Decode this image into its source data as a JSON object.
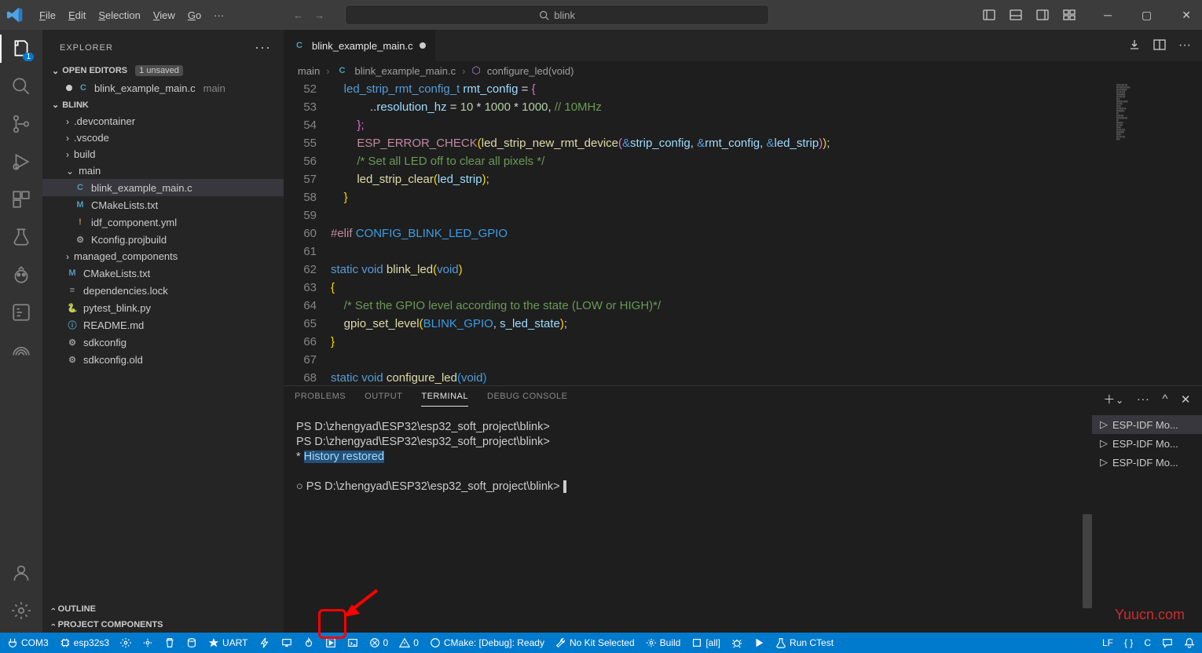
{
  "title": {
    "menus": [
      "File",
      "Edit",
      "Selection",
      "View",
      "Go"
    ],
    "search": "blink"
  },
  "layout_icons": [
    "layout-side",
    "layout-panel",
    "layout-right",
    "layout-grid"
  ],
  "activity": {
    "explorer_badge": "1"
  },
  "sidebar": {
    "title": "EXPLORER",
    "open_editors": {
      "label": "OPEN EDITORS",
      "badge": "1 unsaved"
    },
    "open_file": {
      "name": "blink_example_main.c",
      "folder": "main"
    },
    "project": "BLINK",
    "tree": [
      {
        "d": 1,
        "kind": "folder-closed",
        "label": ".devcontainer"
      },
      {
        "d": 1,
        "kind": "folder-closed",
        "label": ".vscode"
      },
      {
        "d": 1,
        "kind": "folder-closed",
        "label": "build"
      },
      {
        "d": 1,
        "kind": "folder-open",
        "label": "main"
      },
      {
        "d": 2,
        "kind": "c",
        "label": "blink_example_main.c",
        "sel": true
      },
      {
        "d": 2,
        "kind": "m",
        "label": "CMakeLists.txt"
      },
      {
        "d": 2,
        "kind": "ex",
        "label": "idf_component.yml"
      },
      {
        "d": 2,
        "kind": "gear",
        "label": "Kconfig.projbuild"
      },
      {
        "d": 1,
        "kind": "folder-closed",
        "label": "managed_components"
      },
      {
        "d": 1,
        "kind": "m",
        "label": "CMakeLists.txt"
      },
      {
        "d": 1,
        "kind": "lines",
        "label": "dependencies.lock"
      },
      {
        "d": 1,
        "kind": "py",
        "label": "pytest_blink.py"
      },
      {
        "d": 1,
        "kind": "info",
        "label": "README.md"
      },
      {
        "d": 1,
        "kind": "gear",
        "label": "sdkconfig"
      },
      {
        "d": 1,
        "kind": "gear",
        "label": "sdkconfig.old"
      }
    ],
    "outline": "OUTLINE",
    "projcomp": "PROJECT COMPONENTS"
  },
  "editor": {
    "tab": "blink_example_main.c",
    "breadcrumbs": [
      "main",
      "blink_example_main.c",
      "configure_led(void)"
    ],
    "lines": [
      52,
      53,
      54,
      55,
      56,
      57,
      58,
      59,
      60,
      61,
      62,
      63,
      64,
      65,
      66,
      67,
      68
    ],
    "l53_a": ".resolution_hz",
    "l53_b": " = ",
    "l53_c": "10",
    "l53_d": " * ",
    "l53_e": "1000",
    "l53_f": " * ",
    "l53_g": "1000",
    "l53_h": ",",
    "l53_i": " // 10MHz",
    "l54": "};",
    "l55_a": "ESP_ERROR_CHECK",
    "l55_b": "led_strip_new_rmt_device",
    "l55_c": "&",
    "l55_d": "strip_config",
    "l55_e": "rmt_config",
    "l55_f": "led_strip",
    "l56": "/* Set all LED off to clear all pixels */",
    "l57_a": "led_strip_clear",
    "l57_b": "led_strip",
    "l58": "}",
    "l60_a": "#elif",
    "l60_b": " CONFIG_BLINK_LED_GPIO",
    "l62_a": "static",
    "l62_b": "void",
    "l62_c": "blink_led",
    "l62_d": "void",
    "l63": "{",
    "l64": "/* Set the GPIO level according to the state (LOW or HIGH)*/",
    "l65_a": "gpio_set_level",
    "l65_b": "BLINK_GPIO",
    "l65_c": "s_led_state",
    "l66": "}",
    "l68_a": "static",
    "l68_b": "void",
    "l68_c": "configure_led",
    "l68_d": "void"
  },
  "panel": {
    "tabs": [
      "PROBLEMS",
      "OUTPUT",
      "TERMINAL",
      "DEBUG CONSOLE"
    ],
    "active": 2,
    "term_lines": [
      "PS D:\\zhengyad\\ESP32\\esp32_soft_project\\blink>",
      "PS D:\\zhengyad\\ESP32\\esp32_soft_project\\blink>"
    ],
    "hist_prefix": " * ",
    "hist": "History restored",
    "prompt_prefix": "○ ",
    "prompt": "PS D:\\zhengyad\\ESP32\\esp32_soft_project\\blink> ",
    "terms": [
      "ESP-IDF Mo...",
      "ESP-IDF Mo...",
      "ESP-IDF Mo..."
    ]
  },
  "status": {
    "left": [
      {
        "icon": "plug",
        "label": "COM3"
      },
      {
        "icon": "chip",
        "label": "esp32s3"
      },
      {
        "icon": "gear",
        "label": ""
      },
      {
        "icon": "gear2",
        "label": ""
      },
      {
        "icon": "trash",
        "label": ""
      },
      {
        "icon": "db",
        "label": ""
      },
      {
        "icon": "star",
        "label": "UART"
      },
      {
        "icon": "flash",
        "label": ""
      },
      {
        "icon": "monitor",
        "label": ""
      },
      {
        "icon": "flame",
        "label": ""
      },
      {
        "icon": "runbox",
        "label": ""
      },
      {
        "icon": "term",
        "label": ""
      },
      {
        "icon": "err",
        "label": "0"
      },
      {
        "icon": "warn",
        "label": "0"
      },
      {
        "icon": "info",
        "label": "CMake: [Debug]: Ready"
      },
      {
        "icon": "wrench",
        "label": "No Kit Selected"
      },
      {
        "icon": "gearb",
        "label": "Build"
      },
      {
        "icon": "target",
        "label": "[all]"
      },
      {
        "icon": "bug",
        "label": ""
      },
      {
        "icon": "play",
        "label": ""
      },
      {
        "icon": "beaker",
        "label": "Run CTest"
      }
    ],
    "right": [
      "LF",
      "{ }",
      "C"
    ]
  },
  "watermark": "Yuucn.com"
}
